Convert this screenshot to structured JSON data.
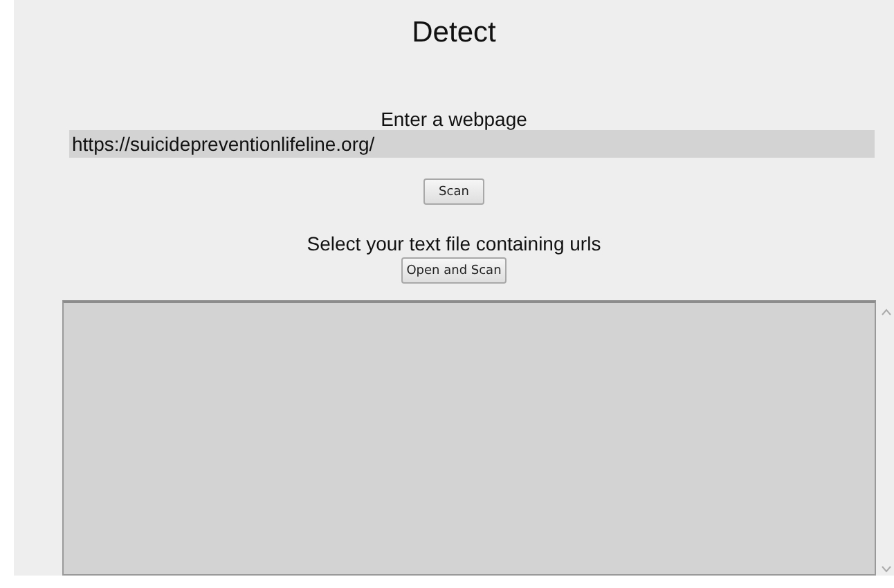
{
  "window": {
    "title": "Detect"
  },
  "url_section": {
    "label": "Enter a webpage",
    "value": "https://suicidepreventionlifeline.org/",
    "button": "Scan"
  },
  "file_section": {
    "label": "Select your text file containing urls",
    "button": "Open and Scan"
  },
  "output": {
    "kind": "textarea"
  }
}
